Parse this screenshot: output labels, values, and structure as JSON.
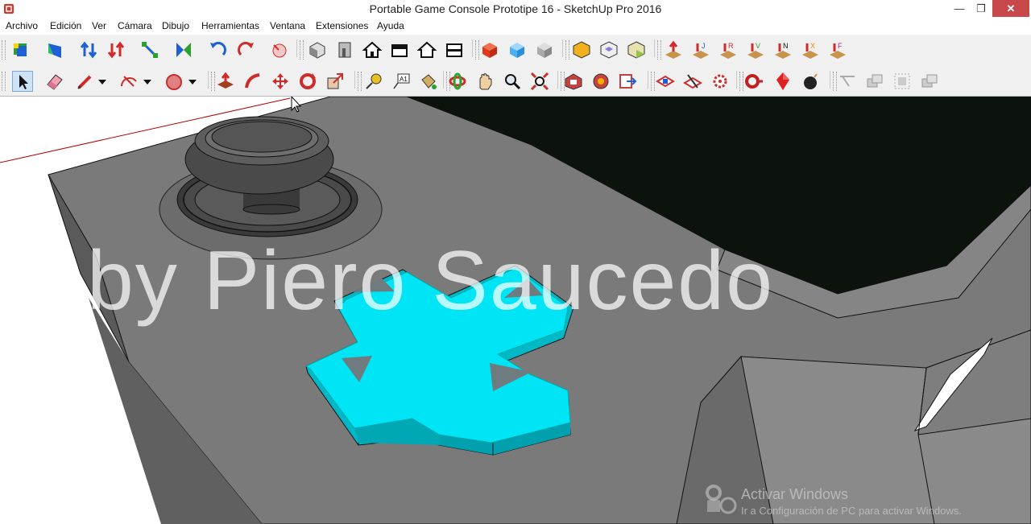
{
  "window": {
    "title": "Portable Game Console Prototipe 16 - SketchUp Pro 2016",
    "minimize_glyph": "—",
    "restore_glyph": "❐",
    "close_glyph": "✕"
  },
  "menu": {
    "items": [
      "Archivo",
      "Edición",
      "Ver",
      "Cámara",
      "Dibujo",
      "Herramientas",
      "Ventana",
      "Extensiones",
      "Ayuda"
    ]
  },
  "toolbar_row1": {
    "groups": [
      {
        "icons": [
          "select-color-icon",
          "paint-face-icon",
          "push-up-icon",
          "push-down-icon",
          "scale-diagonal-icon",
          "flip-icon",
          "rotate-left-icon",
          "rotate-right-icon",
          "undo-style-icon"
        ]
      },
      {
        "icons": [
          "iso-view-icon",
          "front-door-icon",
          "house-view-icon",
          "top-view-icon",
          "house-outline-icon",
          "box-view-icon"
        ]
      },
      {
        "icons": [
          "red-cube-icon",
          "blue-cube-icon",
          "gray-cube-icon"
        ]
      },
      {
        "icons": [
          "solid-union-icon",
          "solid-intersect-icon",
          "solid-subtract-icon"
        ]
      },
      {
        "icons": [
          "add-red-icon",
          "add-j-icon",
          "add-r-icon",
          "add-v-icon",
          "add-n-icon",
          "add-x-icon",
          "add-f-icon"
        ]
      }
    ]
  },
  "toolbar_row2": {
    "groups": [
      {
        "icons": [
          "select-arrow-icon",
          "eraser-icon",
          "pencil-icon",
          "pencil-dropdown-icon",
          "arc-icon",
          "arc-dropdown-icon",
          "polygon-icon",
          "polygon-dropdown-icon"
        ]
      },
      {
        "icons": [
          "push-pull-icon",
          "follow-me-icon",
          "move-icon",
          "rotate-icon",
          "scale-icon"
        ]
      },
      {
        "icons": [
          "tape-measure-icon",
          "text-label-icon",
          "paint-bucket-icon"
        ]
      },
      {
        "icons": [
          "orbit-icon",
          "pan-icon",
          "zoom-icon",
          "zoom-extents-icon"
        ]
      },
      {
        "icons": [
          "warehouse-icon",
          "extensions-icon",
          "send-icon"
        ]
      },
      {
        "icons": [
          "section-plane-icon",
          "section-cut-icon",
          "gear-settings-icon"
        ]
      },
      {
        "icons": [
          "ruby-console-icon",
          "gem-icon",
          "bomb-icon"
        ]
      },
      {
        "icons": [
          "pointer-disabled-icon",
          "layer-disabled-icon",
          "group-disabled-icon",
          "stack-disabled-icon"
        ]
      }
    ]
  },
  "viewport": {
    "watermark": "by Piero Saucedo",
    "activation_title": "Activar Windows",
    "activation_subtitle": "Ir a Configuración de PC para activar Windows.",
    "colors": {
      "dpad": "#00e5f5",
      "console_body": "#7a7a7a",
      "screen": "#0b130c",
      "background": "#ffffff"
    }
  }
}
